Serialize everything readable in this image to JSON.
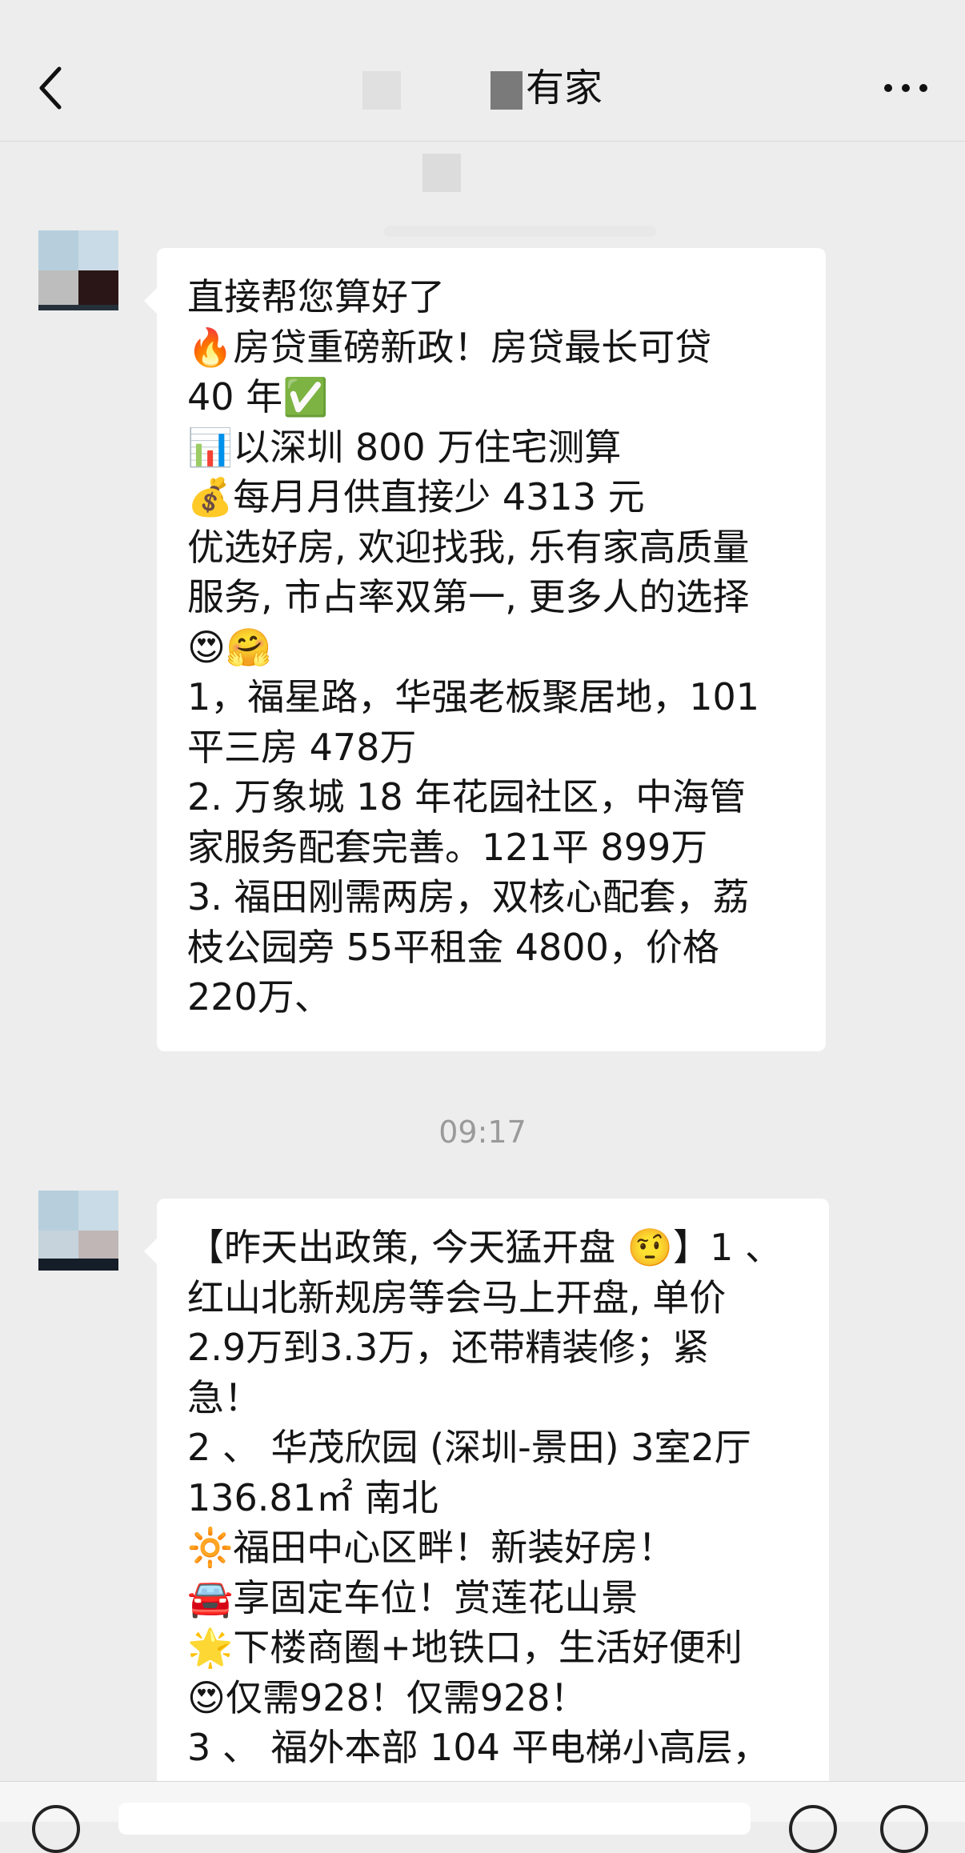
{
  "header": {
    "title": "有家"
  },
  "messages": [
    {
      "lines": [
        "直接帮您算好了",
        "🔥房贷重磅新政！房贷最长可贷",
        "40 年✅",
        "📊以深圳 800 万住宅测算",
        "💰每月月供直接少 4313 元",
        "优选好房, 欢迎找我, 乐有家高质量",
        "服务, 市占率双第一, 更多人的选择",
        "😍🤗",
        "1，福星路，华强老板聚居地，101",
        "平三房 478万",
        "2. 万象城 18 年花园社区，中海管",
        "家服务配套完善。121平 899万",
        "3. 福田刚需两房，双核心配套，荔",
        "枝公园旁 55平租金 4800，价格",
        "220万、"
      ]
    },
    {
      "lines": [
        "【昨天出政策, 今天猛开盘 🤨】1 、",
        "红山北新规房等会马上开盘, 单价",
        "2.9万到3.3万，还带精装修；紧",
        "急！",
        "2 、 华茂欣园 (深圳-景田) 3室2厅",
        "136.81㎡ 南北",
        "🔆福田中心区畔！新装好房！",
        "🚘享固定车位！赏莲花山景",
        "🌟下楼商圈+地铁口，生活好便利",
        "😍仅需928！仅需928！",
        "3 、 福外本部 104 平电梯小高层，"
      ]
    }
  ],
  "timestamp": "09:17"
}
